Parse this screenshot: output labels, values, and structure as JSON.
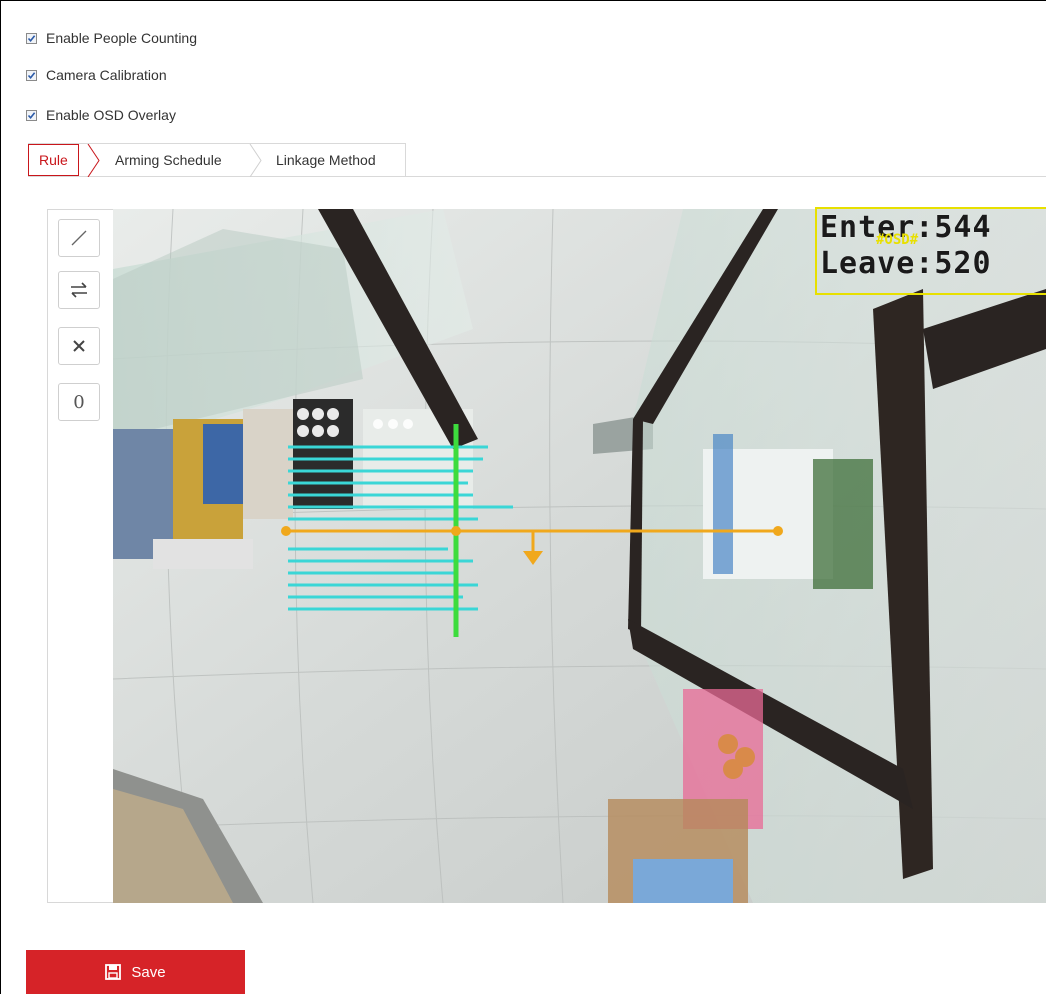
{
  "options": {
    "people_counting": "Enable People Counting",
    "camera_calibration": "Camera Calibration",
    "osd_overlay": "Enable OSD Overlay"
  },
  "tabs": [
    {
      "label": "Rule",
      "active": true
    },
    {
      "label": "Arming Schedule",
      "active": false
    },
    {
      "label": "Linkage Method",
      "active": false
    }
  ],
  "toolbar": {
    "draw_line_icon": "line-icon",
    "direction_icon": "swap-direction-icon",
    "delete_icon": "close-icon",
    "count_reset_label": "0"
  },
  "osd": {
    "enter_text": "Enter:544",
    "leave_text": "Leave:520",
    "tag": "#OSD#"
  },
  "save": {
    "label": "Save"
  },
  "colors": {
    "accent": "#d62328",
    "counting_line": "#f0a81c",
    "calibration_line": "#3ddc3d",
    "calibration_bars": "#3ad6d6",
    "osd_border": "#e7e000"
  }
}
